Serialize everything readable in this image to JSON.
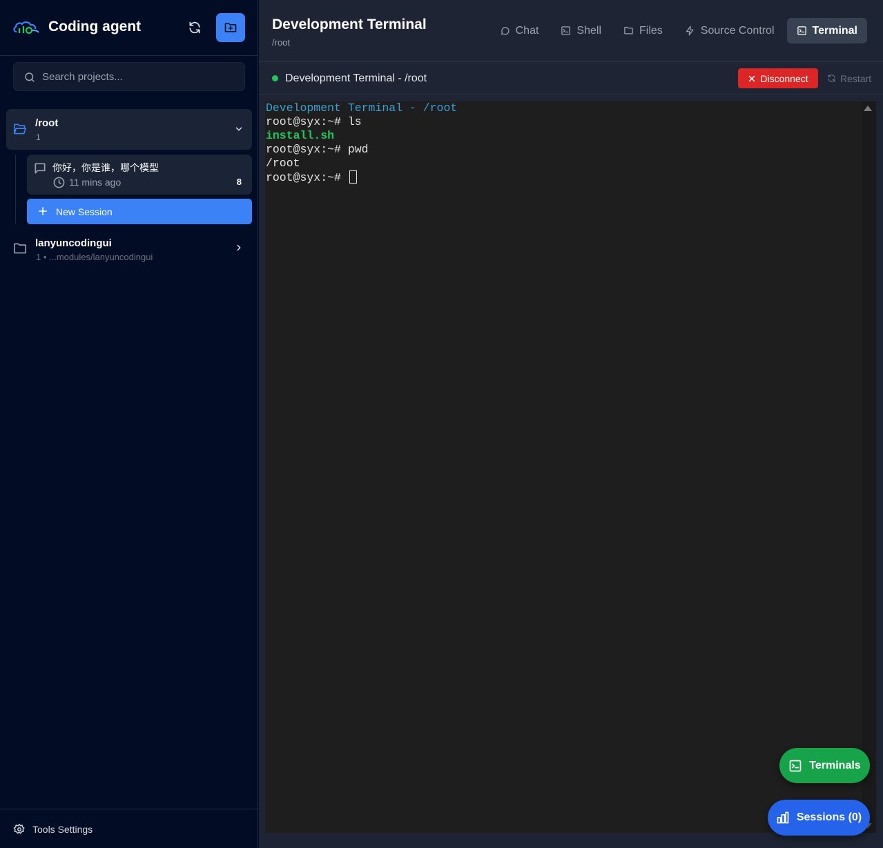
{
  "app": {
    "title": "Coding agent",
    "accent": "#3b82f6"
  },
  "sidebar": {
    "search_placeholder": "Search projects...",
    "projects": [
      {
        "name": "/root",
        "count": "1",
        "expanded": true,
        "sessions": [
          {
            "title": "你好，你是谁，哪个模型",
            "time": "11 mins ago",
            "count": "8"
          }
        ],
        "new_session_label": "New Session"
      },
      {
        "name": "lanyuncodingui",
        "subtitle": "1 • ...modules/lanyuncodingui",
        "expanded": false
      }
    ],
    "footer_label": "Tools Settings"
  },
  "header": {
    "title": "Development Terminal",
    "subtitle": "/root",
    "tabs": [
      {
        "label": "Chat",
        "icon": "chat-icon",
        "active": false
      },
      {
        "label": "Shell",
        "icon": "terminal-icon",
        "active": false
      },
      {
        "label": "Files",
        "icon": "folder-icon",
        "active": false
      },
      {
        "label": "Source Control",
        "icon": "lightning-icon",
        "active": false
      },
      {
        "label": "Terminal",
        "icon": "terminal-icon",
        "active": true
      }
    ]
  },
  "terminal_bar": {
    "title": "Development Terminal - /root",
    "status_color": "#22c55e",
    "disconnect_label": "Disconnect",
    "restart_label": "Restart"
  },
  "terminal": {
    "lines": [
      {
        "text": "Development Terminal - /root",
        "style": "blue"
      },
      {
        "text": "root@syx:~# ls",
        "style": "white"
      },
      {
        "text": "install.sh",
        "style": "green"
      },
      {
        "text": "root@syx:~# pwd",
        "style": "white"
      },
      {
        "text": "/root",
        "style": "white"
      },
      {
        "text": "root@syx:~# ",
        "style": "white",
        "cursor": true
      }
    ]
  },
  "fabs": {
    "terminals_label": "Terminals",
    "sessions_label": "Sessions (0)"
  }
}
